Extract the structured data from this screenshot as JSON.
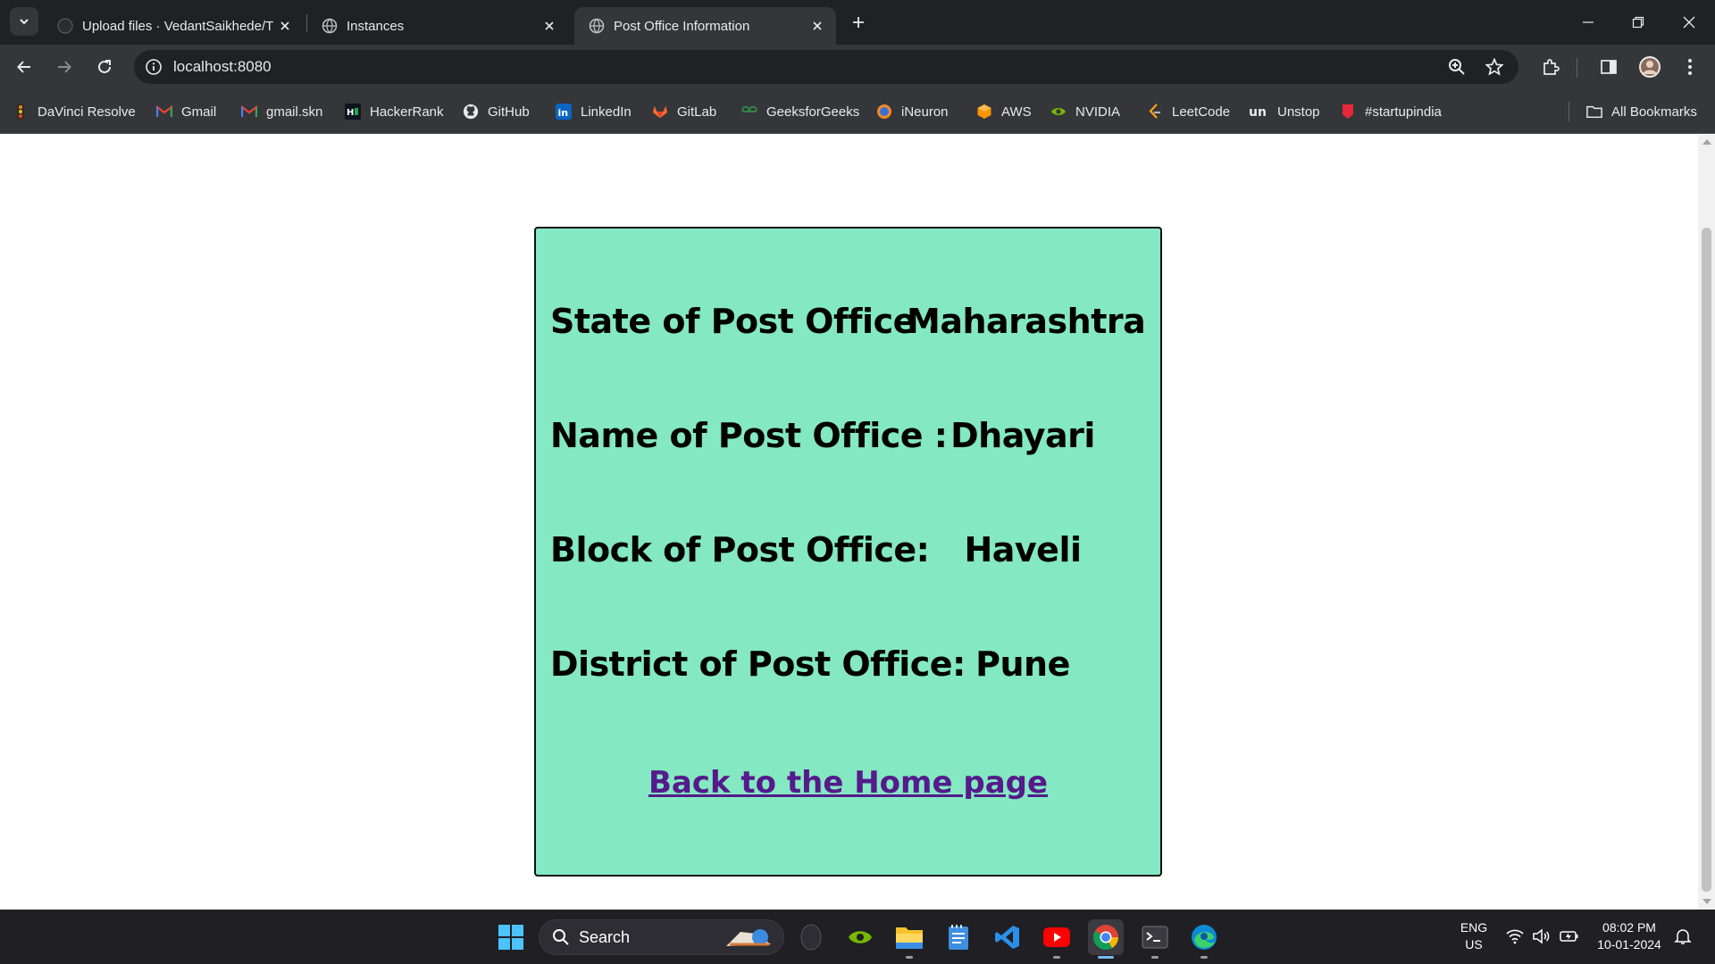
{
  "browser": {
    "tabs": [
      {
        "title": "Upload files · VedantSaikhede/T",
        "active": false
      },
      {
        "title": "Instances",
        "active": false
      },
      {
        "title": "Post Office Information",
        "active": true
      }
    ],
    "url": "localhost:8080",
    "bookmarks": [
      {
        "label": "DaVinci Resolve",
        "icon": "davinci-icon"
      },
      {
        "label": "Gmail",
        "icon": "gmail-icon"
      },
      {
        "label": "gmail.skn",
        "icon": "gmail-icon"
      },
      {
        "label": "HackerRank",
        "icon": "hackerrank-icon"
      },
      {
        "label": "GitHub",
        "icon": "github-icon"
      },
      {
        "label": "LinkedIn",
        "icon": "linkedin-icon"
      },
      {
        "label": "GitLab",
        "icon": "gitlab-icon"
      },
      {
        "label": "GeeksforGeeks",
        "icon": "geeksforgeeks-icon"
      },
      {
        "label": "iNeuron",
        "icon": "ineuron-icon"
      },
      {
        "label": "AWS",
        "icon": "aws-icon"
      },
      {
        "label": "NVIDIA",
        "icon": "nvidia-icon"
      },
      {
        "label": "LeetCode",
        "icon": "leetcode-icon"
      },
      {
        "label": "Unstop",
        "icon": "unstop-icon"
      },
      {
        "label": "#startupindia",
        "icon": "startupindia-icon"
      }
    ],
    "all_bookmarks": "All Bookmarks"
  },
  "page": {
    "rows": [
      {
        "label": "State of Post Office :",
        "value": "Maharashtra"
      },
      {
        "label": "Name of Post Office :",
        "value": "Dhayari"
      },
      {
        "label": "Block of Post Office:",
        "value": "Haveli"
      },
      {
        "label": "District of Post Office:",
        "value": "Pune"
      }
    ],
    "home_link": "Back to the Home page",
    "card_color": "#84e8c2",
    "link_color": "#551a8b"
  },
  "taskbar": {
    "search_label": "Search",
    "language": "ENG",
    "region": "US",
    "time": "08:02 PM",
    "date": "10-01-2024"
  }
}
